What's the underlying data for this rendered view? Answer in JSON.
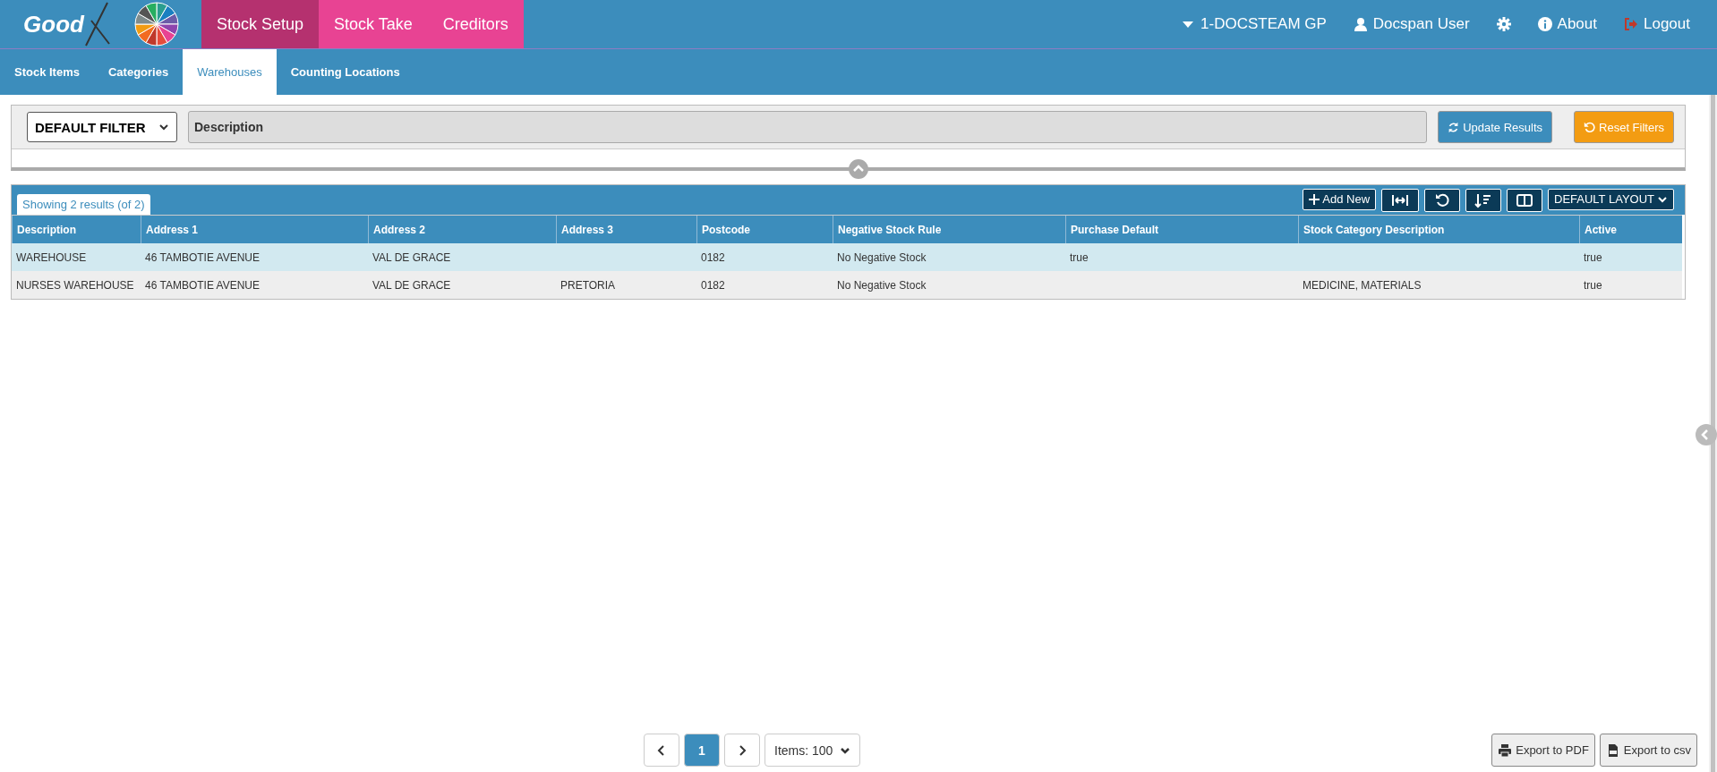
{
  "top_nav": {
    "logo": "Good",
    "modules": [
      {
        "label": "Stock Setup",
        "selected": true
      },
      {
        "label": "Stock Take",
        "selected": false
      },
      {
        "label": "Creditors",
        "selected": false
      }
    ],
    "right": [
      {
        "kind": "dropdown",
        "label": "1-DOCSTEAM GP"
      },
      {
        "kind": "user",
        "label": "Docspan User"
      },
      {
        "kind": "settings"
      },
      {
        "kind": "info",
        "label": "About"
      },
      {
        "kind": "logout",
        "label": "Logout"
      }
    ]
  },
  "sub_tabs": [
    {
      "label": "Stock Items",
      "selected": false
    },
    {
      "label": "Categories",
      "selected": false
    },
    {
      "label": "Warehouses",
      "selected": true
    },
    {
      "label": "Counting Locations",
      "selected": false
    }
  ],
  "filter": {
    "preset": "DEFAULT FILTER",
    "description_placeholder": "Description",
    "update_button": "Update Results",
    "reset_button": "Reset Filters"
  },
  "table": {
    "results_label": "Showing 2 results (of 2)",
    "add_button": "Add New",
    "layout_button": "DEFAULT LAYOUT",
    "columns": [
      "Description",
      "Address 1",
      "Address 2",
      "Address 3",
      "Postcode",
      "Negative Stock Rule",
      "Purchase Default",
      "Stock Category Description",
      "Active"
    ],
    "rows": [
      {
        "selected": true,
        "cells": [
          "WAREHOUSE",
          "46 TAMBOTIE AVENUE",
          "VAL DE GRACE",
          "",
          "0182",
          "No Negative Stock",
          "true",
          "",
          "true"
        ]
      },
      {
        "selected": false,
        "cells": [
          "NURSES WAREHOUSE",
          "46 TAMBOTIE AVENUE",
          "VAL DE GRACE",
          "PRETORIA",
          "0182",
          "No Negative Stock",
          "",
          "MEDICINE, MATERIALS",
          "true"
        ]
      }
    ]
  },
  "pagination": {
    "pages": [
      {
        "label": "1",
        "selected": true
      }
    ],
    "items_per_page": "Items: 100"
  },
  "export_buttons": [
    {
      "kind": "pdf",
      "label": "Export to PDF"
    },
    {
      "kind": "csv",
      "label": "Export to csv"
    }
  ]
}
